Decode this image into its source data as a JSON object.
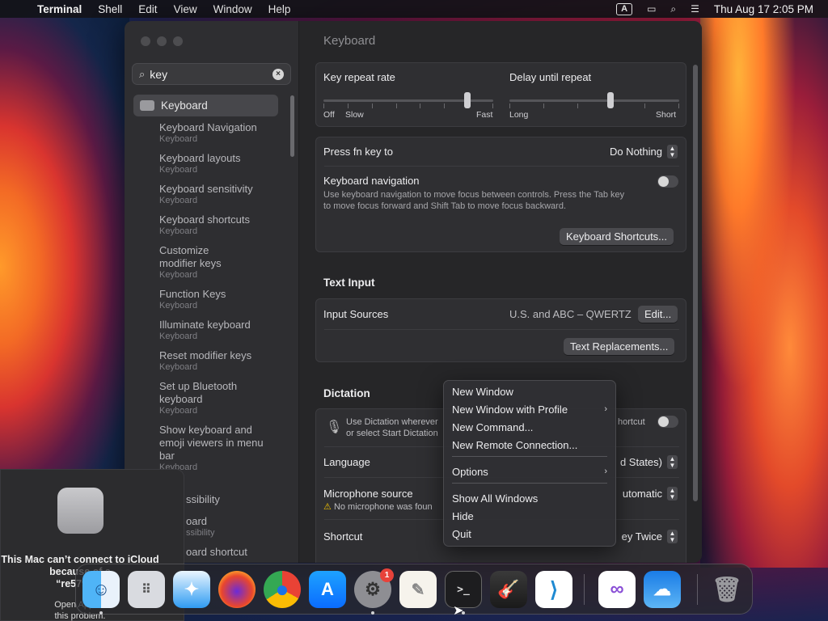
{
  "menubar": {
    "app": "Terminal",
    "menus": [
      "Shell",
      "Edit",
      "View",
      "Window",
      "Help"
    ],
    "input_indicator": "A",
    "datetime": "Thu Aug 17  2:05 PM"
  },
  "window": {
    "search_value": "key",
    "sidebar": {
      "selected": "Keyboard",
      "items": [
        {
          "title": "Keyboard Navigation",
          "sub": "Keyboard"
        },
        {
          "title": "Keyboard layouts",
          "sub": "Keyboard"
        },
        {
          "title": "Keyboard sensitivity",
          "sub": "Keyboard"
        },
        {
          "title": "Keyboard shortcuts",
          "sub": "Keyboard"
        },
        {
          "title": "Customize",
          "title2": "modifier keys",
          "sub": "Keyboard"
        },
        {
          "title": "Function Keys",
          "sub": "Keyboard"
        },
        {
          "title": "Illuminate keyboard",
          "sub": "Keyboard"
        },
        {
          "title": "Reset modifier keys",
          "sub": "Keyboard"
        },
        {
          "title": "Set up Bluetooth",
          "title2": "keyboard",
          "sub": "Keyboard"
        },
        {
          "title": "Show keyboard and",
          "title2": "emoji viewers in menu",
          "title3": "bar",
          "sub": "Keyboard"
        },
        {
          "title": "ssibility"
        },
        {
          "title": "oard",
          "sub": "ssibility"
        },
        {
          "title": "oard shortcut"
        }
      ]
    },
    "content": {
      "title": "Keyboard",
      "key_repeat": {
        "label": "Key repeat rate",
        "off": "Off",
        "slow": "Slow",
        "fast": "Fast",
        "level": 0.86
      },
      "delay": {
        "label": "Delay until repeat",
        "long": "Long",
        "short": "Short",
        "level": 0.6
      },
      "fn_key": {
        "label": "Press fn key to",
        "value": "Do Nothing"
      },
      "kbd_nav": {
        "label": "Keyboard navigation",
        "desc1": "Use keyboard navigation to move focus between controls. Press the Tab key",
        "desc2": "to move focus forward and Shift Tab to move focus backward.",
        "enabled": false
      },
      "shortcuts_button": "Keyboard Shortcuts...",
      "text_input": {
        "heading": "Text Input",
        "input_sources_label": "Input Sources",
        "input_sources_value": "U.S. and ABC – QWERTZ",
        "edit_button": "Edit...",
        "replacements_button": "Text Replacements..."
      },
      "dictation": {
        "heading": "Dictation",
        "desc1": "Use Dictation wherever",
        "desc2": "or select Start Dictation",
        "shortcut_partial": "hortcut",
        "language_label": "Language",
        "language_value": "d States)",
        "mic_label": "Microphone source",
        "mic_warning": "No microphone was foun",
        "mic_value": "utomatic",
        "shortcut_label": "Shortcut",
        "shortcut_value": "ey Twice"
      }
    }
  },
  "context_menu": {
    "items": [
      {
        "label": "New Window"
      },
      {
        "label": "New Window with Profile",
        "submenu": true
      },
      {
        "label": "New Command..."
      },
      {
        "label": "New Remote Connection..."
      },
      {
        "label": "Options",
        "submenu": true
      },
      {
        "label": "Show All Windows"
      },
      {
        "label": "Hide"
      },
      {
        "label": "Quit"
      }
    ]
  },
  "notification": {
    "line1": "This Mac can’t connect to iCloud",
    "line2": "because of a",
    "line3": "“re579082",
    "line4": "Open Apple I",
    "line5": "this problem."
  },
  "dock": {
    "settings_badge": "1",
    "apps": [
      "Finder",
      "Launchpad",
      "Safari",
      "Firefox",
      "Chrome",
      "App Store",
      "System Settings",
      "TextEdit",
      "Terminal",
      "GarageBand",
      "VS Code",
      "Visual Studio",
      "Weather",
      "Trash"
    ]
  }
}
